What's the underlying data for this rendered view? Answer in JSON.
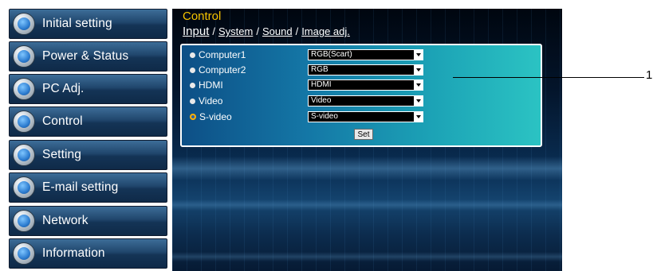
{
  "sidebar": {
    "items": [
      {
        "label": "Initial setting",
        "icon": "initial-setting-icon"
      },
      {
        "label": "Power & Status",
        "icon": "power-status-icon"
      },
      {
        "label": "PC Adj.",
        "icon": "pc-adjust-icon"
      },
      {
        "label": "Control",
        "icon": "control-icon"
      },
      {
        "label": "Setting",
        "icon": "setting-icon"
      },
      {
        "label": "E-mail setting",
        "icon": "email-icon"
      },
      {
        "label": "Network",
        "icon": "network-icon"
      },
      {
        "label": "Information",
        "icon": "information-icon"
      }
    ]
  },
  "main": {
    "title": "Control",
    "tabs": [
      "Input",
      "System",
      "Sound",
      "Image adj."
    ],
    "tab_separator": "/",
    "inputs": [
      {
        "label": "Computer1",
        "value": "RGB(Scart)",
        "selected": false
      },
      {
        "label": "Computer2",
        "value": "RGB",
        "selected": false
      },
      {
        "label": "HDMI",
        "value": "HDMI",
        "selected": false
      },
      {
        "label": "Video",
        "value": "Video",
        "selected": false
      },
      {
        "label": "S-video",
        "value": "S-video",
        "selected": true
      }
    ],
    "set_label": "Set"
  },
  "callout": {
    "number": "1"
  },
  "colors": {
    "title": "#f6c400",
    "radio_selected": "#ffb000",
    "nav_bg": "#20466c"
  }
}
